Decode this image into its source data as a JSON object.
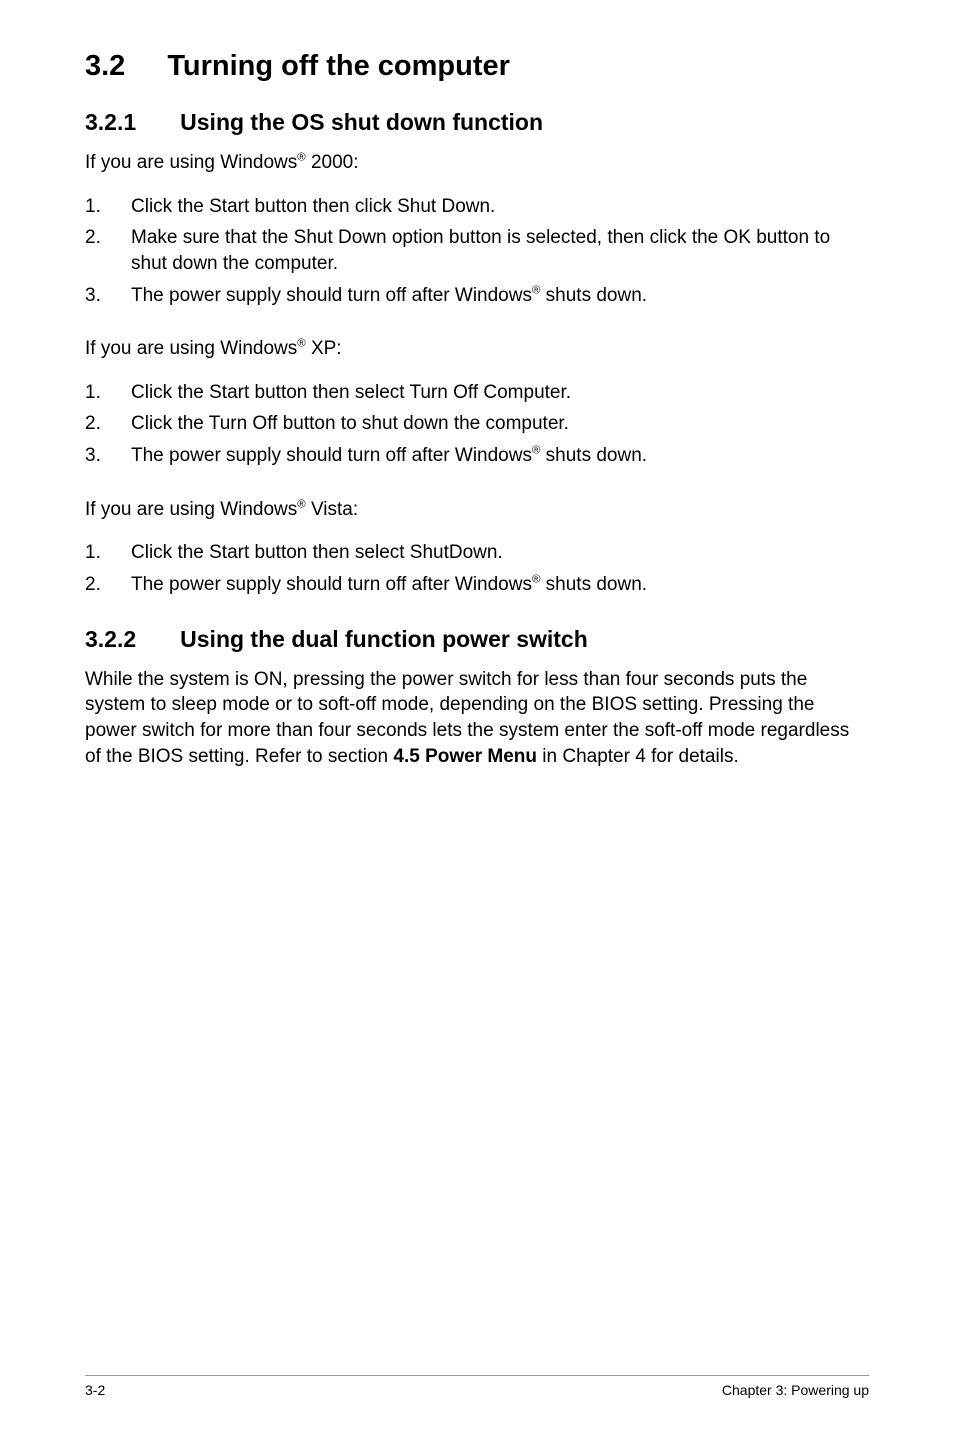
{
  "section": {
    "number": "3.2",
    "title": "Turning off the computer"
  },
  "sub1": {
    "number": "3.2.1",
    "title": "Using the OS shut down function",
    "blocks": [
      {
        "intro_pre": "If you are using Windows",
        "intro_post": " 2000:",
        "steps": [
          "Click the Start button then click Shut Down.",
          "Make sure that the Shut Down option button is selected, then click the OK button to shut down the computer.",
          {
            "pre": "The power supply should turn off after Windows",
            "post": " shuts down."
          }
        ]
      },
      {
        "intro_pre": "If you are using Windows",
        "intro_post": " XP:",
        "steps": [
          "Click the Start button then select Turn Off Computer.",
          "Click the Turn Off button to shut down the computer.",
          {
            "pre": "The power supply should turn off after Windows",
            "post": " shuts down."
          }
        ]
      },
      {
        "intro_pre": "If you are using Windows",
        "intro_post": " Vista:",
        "steps": [
          "Click the Start button then select ShutDown.",
          {
            "pre": "The power supply should turn off after Windows",
            "post": " shuts down."
          }
        ]
      }
    ]
  },
  "sub2": {
    "number": "3.2.2",
    "title": "Using the dual function power switch",
    "para_pre": "While the system is ON, pressing the power switch for less than four seconds puts the system to sleep mode or to soft-off mode, depending on the BIOS setting. Pressing the power switch for more than four seconds lets the system enter the soft-off mode regardless of the BIOS setting. Refer to section ",
    "para_bold": "4.5  Power Menu",
    "para_post": " in Chapter 4 for details."
  },
  "footer": {
    "left": "3-2",
    "right": "Chapter 3: Powering up"
  },
  "reg_mark": "®"
}
